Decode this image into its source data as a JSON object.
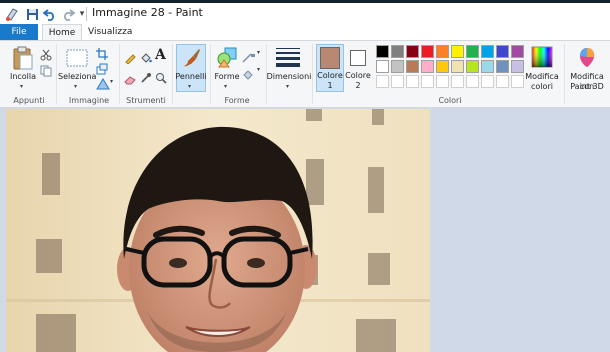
{
  "window": {
    "title": "Immagine 28 - Paint"
  },
  "quick_access": {
    "more_label": "▾"
  },
  "tabs": [
    {
      "label": "File"
    },
    {
      "label": "Home"
    },
    {
      "label": "Visualizza"
    }
  ],
  "ribbon": {
    "clipboard": {
      "paste_label": "Incolla",
      "group_label": "Appunti"
    },
    "image": {
      "select_label": "Seleziona",
      "group_label": "Immagine"
    },
    "tools": {
      "group_label": "Strumenti"
    },
    "brushes": {
      "label": "Pennelli"
    },
    "shapes": {
      "label": "Forme",
      "group_label": "Forme"
    },
    "size": {
      "label": "Dimensioni"
    },
    "color1": {
      "label_line1": "Colore",
      "label_line2": "1",
      "value": "#b98872"
    },
    "color2": {
      "label_line1": "Colore",
      "label_line2": "2",
      "value": "#ffffff"
    },
    "colors": {
      "group_label": "Colori",
      "palette_row1": [
        "#000000",
        "#7f7f7f",
        "#880015",
        "#ed1c24",
        "#ff7f27",
        "#fff200",
        "#22b14c",
        "#00a2e8",
        "#3f48cc",
        "#a349a4"
      ],
      "palette_row2": [
        "#ffffff",
        "#c3c3c3",
        "#b97a57",
        "#ffaec9",
        "#ffc90e",
        "#efe4b0",
        "#b5e61d",
        "#99d9ea",
        "#7092be",
        "#c8bfe7"
      ],
      "edit_label_line1": "Modifica",
      "edit_label_line2": "colori"
    },
    "paint3d": {
      "label_line1": "Modifica con",
      "label_line2": "Paint 3D"
    }
  }
}
